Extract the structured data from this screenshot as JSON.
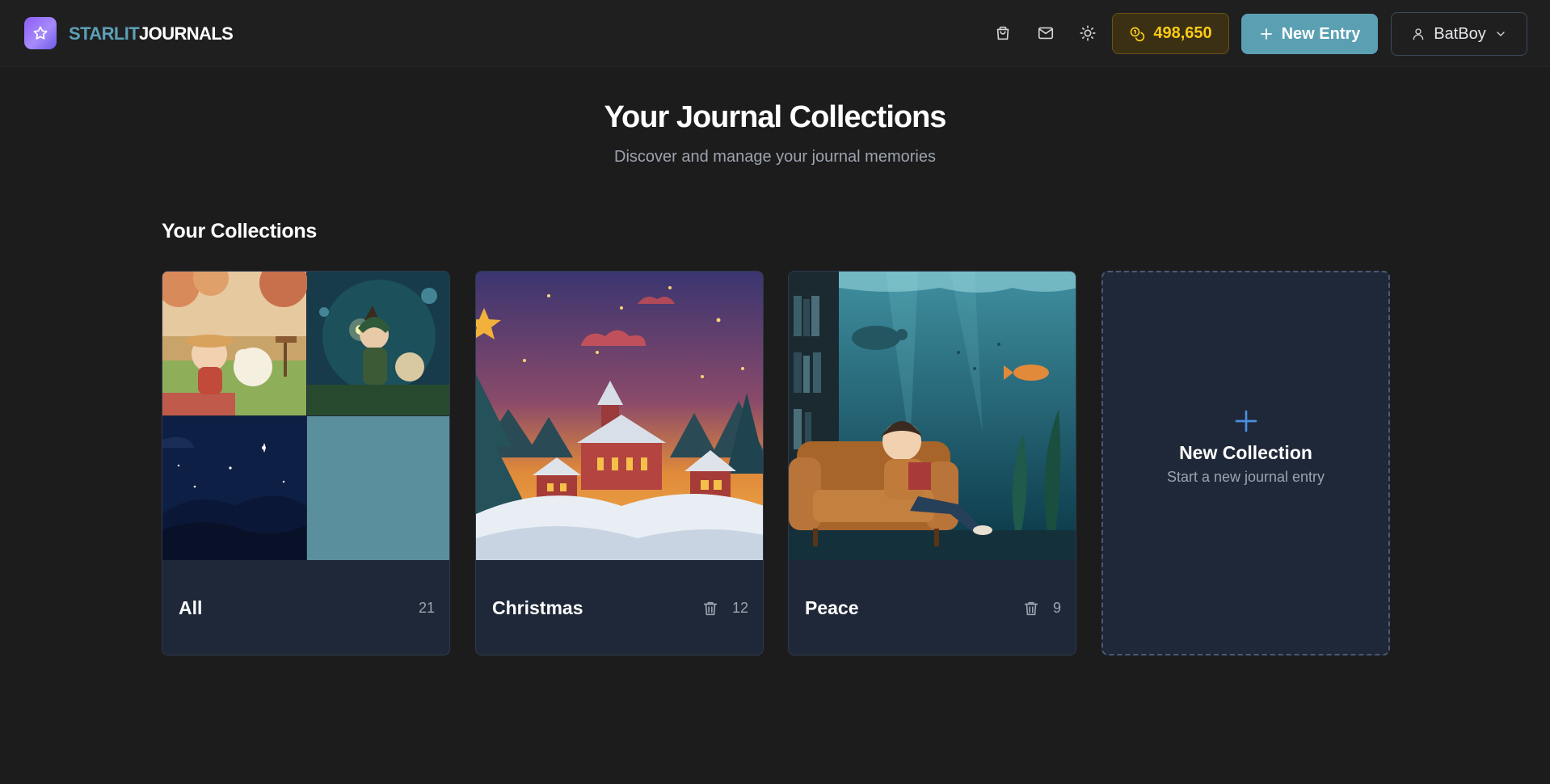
{
  "brand": {
    "part1": "STARLIT",
    "part2": "JOURNALS"
  },
  "header": {
    "coins": "498,650",
    "new_entry_label": "New Entry",
    "user_name": "BatBoy"
  },
  "hero": {
    "title": "Your Journal Collections",
    "subtitle": "Discover and manage your journal memories"
  },
  "section_title": "Your Collections",
  "collections": [
    {
      "name": "All",
      "count": "21"
    },
    {
      "name": "Christmas",
      "count": "12"
    },
    {
      "name": "Peace",
      "count": "9"
    }
  ],
  "new_collection": {
    "title": "New Collection",
    "subtitle": "Start a new journal entry"
  },
  "colors": {
    "accent": "#5b9fb3",
    "coin_text": "#facc15",
    "card_bg": "#1f2838",
    "page_bg": "#1c1c1c"
  },
  "icons": [
    "star-icon",
    "shopping-bag-icon",
    "mail-icon",
    "sun-icon",
    "coins-icon",
    "plus-icon",
    "user-icon",
    "chevron-down-icon",
    "trash-icon"
  ]
}
